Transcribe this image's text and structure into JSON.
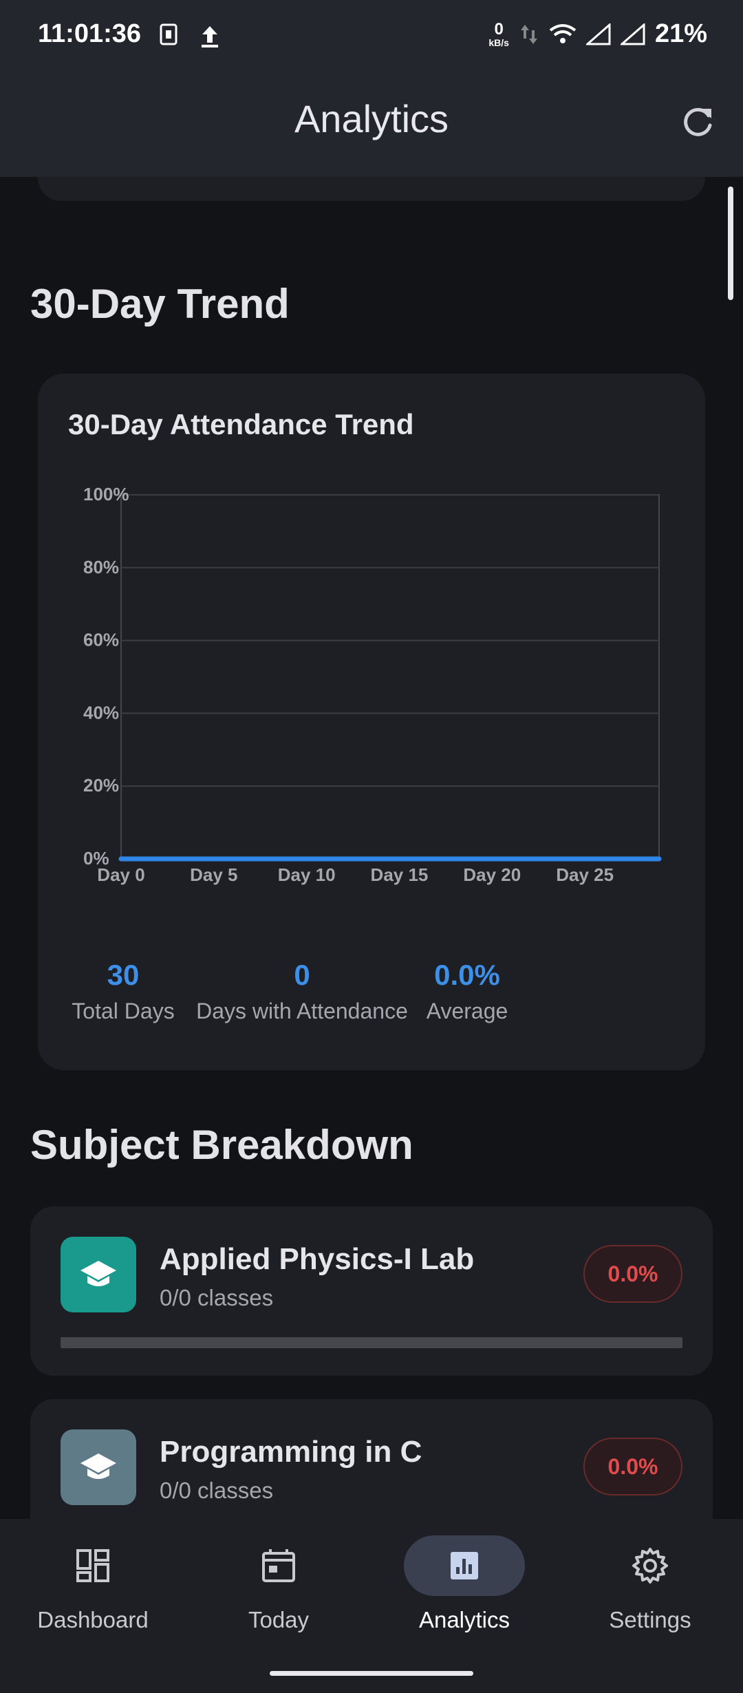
{
  "status_bar": {
    "time": "11:01:36",
    "net_speed_value": "0",
    "net_speed_unit": "kB/s",
    "battery": "21%"
  },
  "app_bar": {
    "title": "Analytics",
    "refresh_icon": "refresh-icon"
  },
  "sections": {
    "trend_title": "30-Day Trend",
    "breakdown_title": "Subject Breakdown"
  },
  "trend_card": {
    "title": "30-Day Attendance Trend",
    "stats": [
      {
        "value": "30",
        "label": "Total Days"
      },
      {
        "value": "0",
        "label": "Days with Attendance"
      },
      {
        "value": "0.0%",
        "label": "Average"
      }
    ]
  },
  "chart_data": {
    "type": "line",
    "title": "30-Day Attendance Trend",
    "xlabel": "",
    "ylabel": "",
    "x_ticks": [
      "Day 0",
      "Day 5",
      "Day 10",
      "Day 15",
      "Day 20",
      "Day 25"
    ],
    "y_ticks": [
      "0%",
      "20%",
      "40%",
      "60%",
      "80%",
      "100%"
    ],
    "xlim": [
      0,
      29
    ],
    "ylim": [
      0,
      100
    ],
    "grid": true,
    "series": [
      {
        "x": [
          0,
          1,
          2,
          3,
          4,
          5,
          6,
          7,
          8,
          9,
          10,
          11,
          12,
          13,
          14,
          15,
          16,
          17,
          18,
          19,
          20,
          21,
          22,
          23,
          24,
          25,
          26,
          27,
          28,
          29
        ],
        "values": [
          0,
          0,
          0,
          0,
          0,
          0,
          0,
          0,
          0,
          0,
          0,
          0,
          0,
          0,
          0,
          0,
          0,
          0,
          0,
          0,
          0,
          0,
          0,
          0,
          0,
          0,
          0,
          0,
          0,
          0
        ],
        "color": "#2f86e6"
      }
    ]
  },
  "subjects": [
    {
      "name": "Applied Physics-I Lab",
      "classes": "0/0 classes",
      "percent": "0.0%",
      "progress": 0,
      "icon_color": "#1a9a8c",
      "icon": "graduation-cap-icon"
    },
    {
      "name": "Programming in C",
      "classes": "0/0 classes",
      "percent": "0.0%",
      "progress": 0,
      "icon_color": "#5f7b88",
      "icon": "graduation-cap-icon"
    }
  ],
  "bottom_nav": [
    {
      "label": "Dashboard",
      "icon": "dashboard-icon",
      "active": false
    },
    {
      "label": "Today",
      "icon": "calendar-icon",
      "active": false
    },
    {
      "label": "Analytics",
      "icon": "analytics-icon",
      "active": true
    },
    {
      "label": "Settings",
      "icon": "gear-icon",
      "active": false
    }
  ],
  "colors": {
    "accent": "#3d8fe8",
    "danger": "#e24b4b",
    "surface": "#1d1f25",
    "background": "#121317"
  }
}
